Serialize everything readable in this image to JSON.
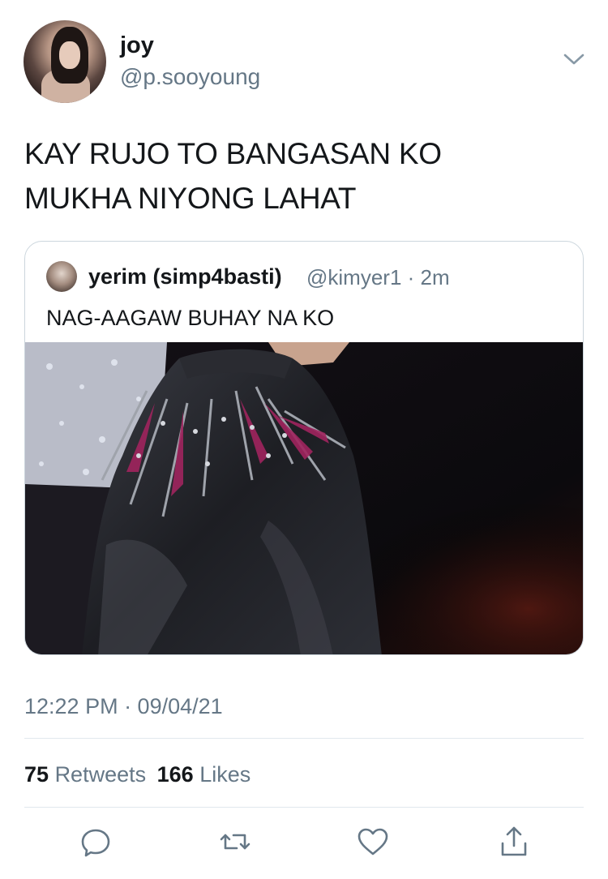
{
  "tweet": {
    "display_name": "joy",
    "handle": "@p.sooyoung",
    "text_line_1": "KAY RUJO TO BANGASAN KO",
    "text_line_2": "MUKHA NIYONG LAHAT",
    "timestamp": "12:22 PM · 09/04/21"
  },
  "quoted_tweet": {
    "display_name": "yerim (simp4basti)",
    "handle_time": "@kimyer1 · 2m",
    "text": "NAG-AAGAW BUHAY NA KO"
  },
  "stats": {
    "retweets_count": "75",
    "retweets_label": "Retweets",
    "likes_count": "166",
    "likes_label": "Likes"
  },
  "icons": {
    "more": "chevron-down-icon",
    "reply": "reply-icon",
    "retweet": "retweet-icon",
    "like": "heart-icon",
    "share": "share-icon"
  },
  "colors": {
    "text_primary": "#14171a",
    "text_secondary": "#657786",
    "border": "#ccd6dd",
    "divider": "#e1e8ed"
  }
}
